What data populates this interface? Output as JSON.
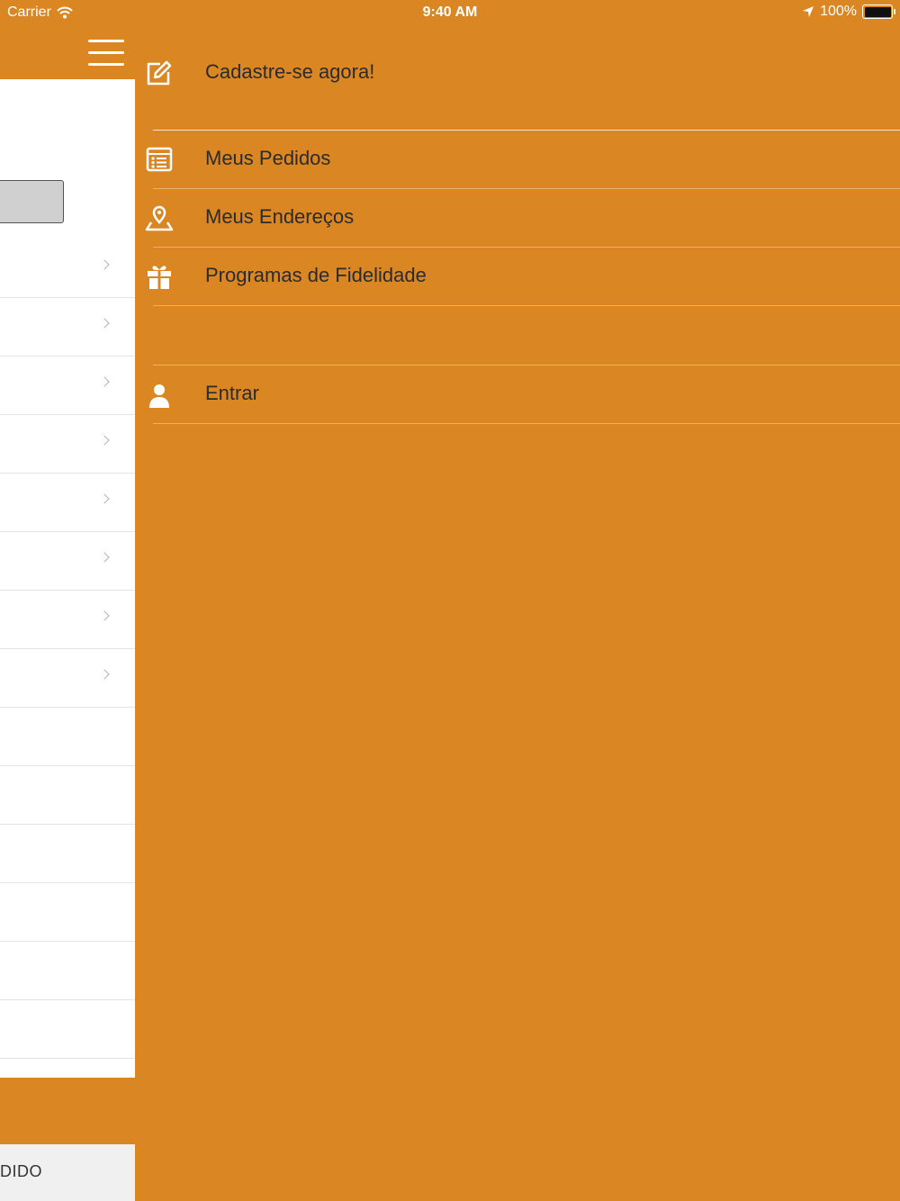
{
  "status_bar": {
    "carrier": "Carrier",
    "time": "9:40 AM",
    "battery": "100%"
  },
  "drawer": {
    "register": {
      "label": "Cadastre-se agora!",
      "icon": "edit-icon"
    },
    "items": [
      {
        "label": "Meus Pedidos",
        "icon": "orders-list-icon"
      },
      {
        "label": "Meus Endereços",
        "icon": "map-pin-icon"
      },
      {
        "label": "Programas de Fidelidade",
        "icon": "gift-icon"
      }
    ],
    "login": {
      "label": "Entrar",
      "icon": "user-icon"
    }
  },
  "main": {
    "bottom_button_label": "DIDO"
  },
  "colors": {
    "accent": "#DA8723",
    "text": "#2B2B2B",
    "panel": "#FFFFFF"
  }
}
